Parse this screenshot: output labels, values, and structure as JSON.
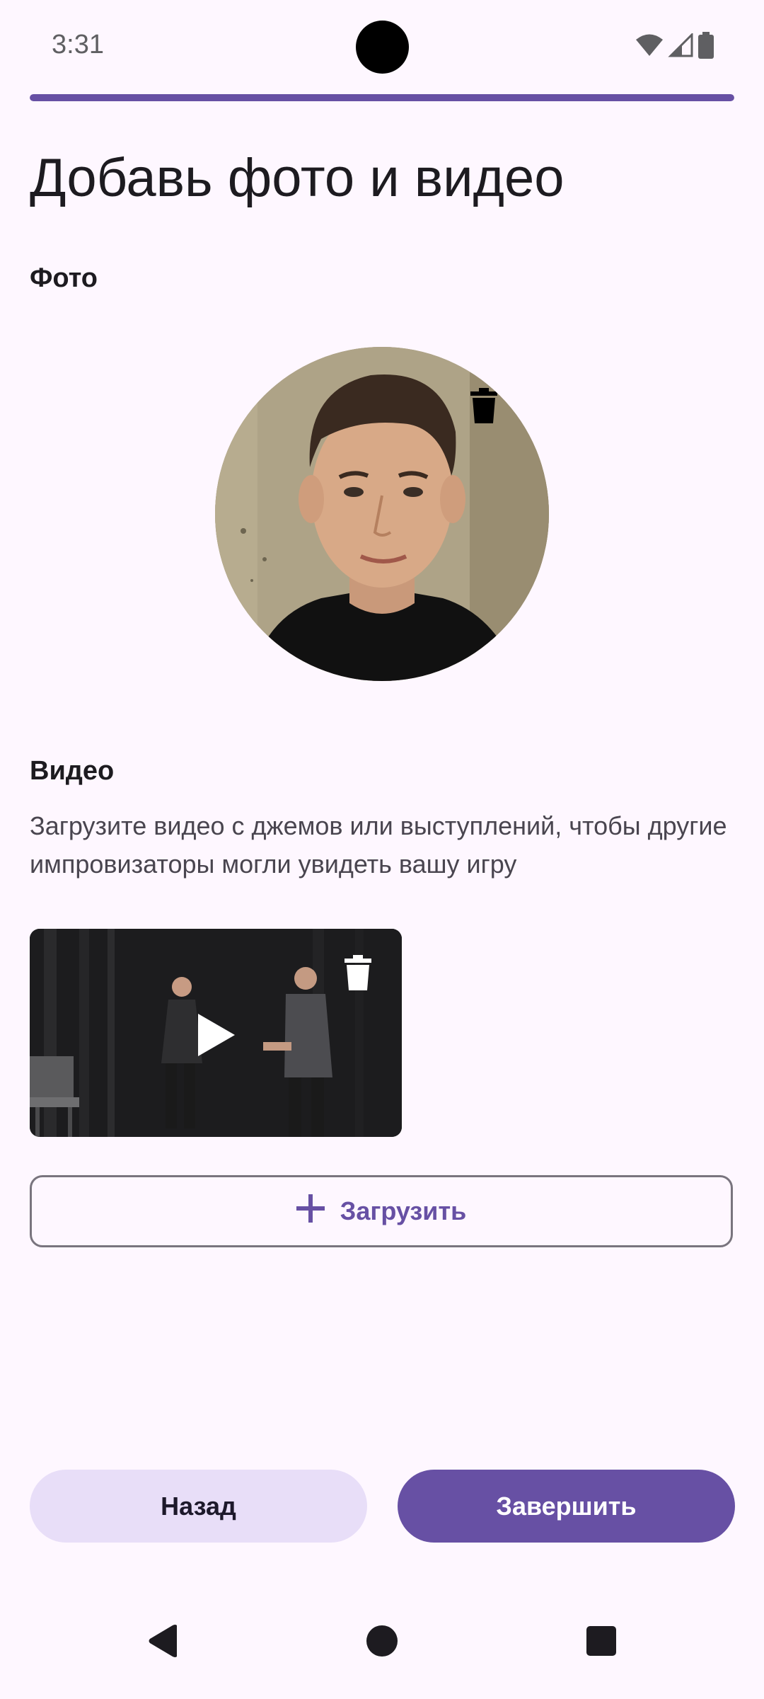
{
  "status_bar": {
    "time": "3:31",
    "icons": [
      "wifi-icon",
      "signal-icon",
      "battery-icon"
    ]
  },
  "progress": {
    "value": 1.0
  },
  "title": "Добавь фото и видео",
  "photo_section": {
    "label": "Фото",
    "delete_icon": "trash-icon"
  },
  "video_section": {
    "label": "Видео",
    "description": "Загрузите видео с джемов или выступлений, чтобы другие импровизаторы могли увидеть вашу игру",
    "delete_icon": "trash-icon",
    "play_icon": "play-icon"
  },
  "upload_button": {
    "label": "Загрузить",
    "icon": "plus-icon"
  },
  "actions": {
    "back_label": "Назад",
    "finish_label": "Завершить"
  },
  "nav": {
    "back_icon": "back-triangle-icon",
    "home_icon": "home-circle-icon",
    "recents_icon": "recents-square-icon"
  },
  "colors": {
    "background": "#FEF7FF",
    "primary": "#6750A4",
    "secondary_container": "#E8DEF8",
    "on_surface": "#1D1B20"
  }
}
